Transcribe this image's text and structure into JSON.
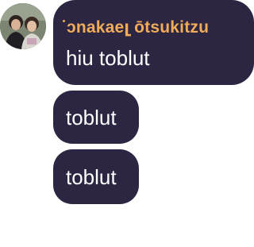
{
  "message_group": {
    "author_name": "ↄnakaeլ ōtsukitzu",
    "messages": [
      {
        "text": "hiu toblut"
      },
      {
        "text": "toblut"
      },
      {
        "text": "toblut"
      }
    ]
  },
  "colors": {
    "bubble_bg": "#2c2643",
    "author_name": "#f0ac58",
    "message_text": "#ffffff",
    "page_bg": "#ffffff"
  }
}
